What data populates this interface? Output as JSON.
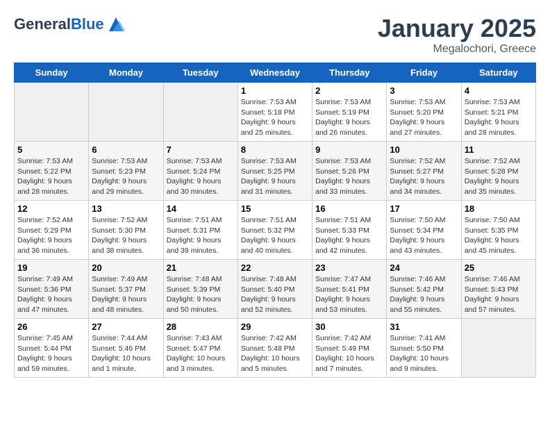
{
  "header": {
    "logo_general": "General",
    "logo_blue": "Blue",
    "main_title": "January 2025",
    "subtitle": "Megalochori, Greece"
  },
  "days_of_week": [
    "Sunday",
    "Monday",
    "Tuesday",
    "Wednesday",
    "Thursday",
    "Friday",
    "Saturday"
  ],
  "weeks": [
    [
      {
        "day": "",
        "empty": true
      },
      {
        "day": "",
        "empty": true
      },
      {
        "day": "",
        "empty": true
      },
      {
        "day": "1",
        "sunrise": "7:53 AM",
        "sunset": "5:18 PM",
        "daylight": "9 hours and 25 minutes."
      },
      {
        "day": "2",
        "sunrise": "7:53 AM",
        "sunset": "5:19 PM",
        "daylight": "9 hours and 26 minutes."
      },
      {
        "day": "3",
        "sunrise": "7:53 AM",
        "sunset": "5:20 PM",
        "daylight": "9 hours and 27 minutes."
      },
      {
        "day": "4",
        "sunrise": "7:53 AM",
        "sunset": "5:21 PM",
        "daylight": "9 hours and 28 minutes."
      }
    ],
    [
      {
        "day": "5",
        "sunrise": "7:53 AM",
        "sunset": "5:22 PM",
        "daylight": "9 hours and 28 minutes."
      },
      {
        "day": "6",
        "sunrise": "7:53 AM",
        "sunset": "5:23 PM",
        "daylight": "9 hours and 29 minutes."
      },
      {
        "day": "7",
        "sunrise": "7:53 AM",
        "sunset": "5:24 PM",
        "daylight": "9 hours and 30 minutes."
      },
      {
        "day": "8",
        "sunrise": "7:53 AM",
        "sunset": "5:25 PM",
        "daylight": "9 hours and 31 minutes."
      },
      {
        "day": "9",
        "sunrise": "7:53 AM",
        "sunset": "5:26 PM",
        "daylight": "9 hours and 33 minutes."
      },
      {
        "day": "10",
        "sunrise": "7:52 AM",
        "sunset": "5:27 PM",
        "daylight": "9 hours and 34 minutes."
      },
      {
        "day": "11",
        "sunrise": "7:52 AM",
        "sunset": "5:28 PM",
        "daylight": "9 hours and 35 minutes."
      }
    ],
    [
      {
        "day": "12",
        "sunrise": "7:52 AM",
        "sunset": "5:29 PM",
        "daylight": "9 hours and 36 minutes."
      },
      {
        "day": "13",
        "sunrise": "7:52 AM",
        "sunset": "5:30 PM",
        "daylight": "9 hours and 38 minutes."
      },
      {
        "day": "14",
        "sunrise": "7:51 AM",
        "sunset": "5:31 PM",
        "daylight": "9 hours and 39 minutes."
      },
      {
        "day": "15",
        "sunrise": "7:51 AM",
        "sunset": "5:32 PM",
        "daylight": "9 hours and 40 minutes."
      },
      {
        "day": "16",
        "sunrise": "7:51 AM",
        "sunset": "5:33 PM",
        "daylight": "9 hours and 42 minutes."
      },
      {
        "day": "17",
        "sunrise": "7:50 AM",
        "sunset": "5:34 PM",
        "daylight": "9 hours and 43 minutes."
      },
      {
        "day": "18",
        "sunrise": "7:50 AM",
        "sunset": "5:35 PM",
        "daylight": "9 hours and 45 minutes."
      }
    ],
    [
      {
        "day": "19",
        "sunrise": "7:49 AM",
        "sunset": "5:36 PM",
        "daylight": "9 hours and 47 minutes."
      },
      {
        "day": "20",
        "sunrise": "7:49 AM",
        "sunset": "5:37 PM",
        "daylight": "9 hours and 48 minutes."
      },
      {
        "day": "21",
        "sunrise": "7:48 AM",
        "sunset": "5:39 PM",
        "daylight": "9 hours and 50 minutes."
      },
      {
        "day": "22",
        "sunrise": "7:48 AM",
        "sunset": "5:40 PM",
        "daylight": "9 hours and 52 minutes."
      },
      {
        "day": "23",
        "sunrise": "7:47 AM",
        "sunset": "5:41 PM",
        "daylight": "9 hours and 53 minutes."
      },
      {
        "day": "24",
        "sunrise": "7:46 AM",
        "sunset": "5:42 PM",
        "daylight": "9 hours and 55 minutes."
      },
      {
        "day": "25",
        "sunrise": "7:46 AM",
        "sunset": "5:43 PM",
        "daylight": "9 hours and 57 minutes."
      }
    ],
    [
      {
        "day": "26",
        "sunrise": "7:45 AM",
        "sunset": "5:44 PM",
        "daylight": "9 hours and 59 minutes."
      },
      {
        "day": "27",
        "sunrise": "7:44 AM",
        "sunset": "5:46 PM",
        "daylight": "10 hours and 1 minute."
      },
      {
        "day": "28",
        "sunrise": "7:43 AM",
        "sunset": "5:47 PM",
        "daylight": "10 hours and 3 minutes."
      },
      {
        "day": "29",
        "sunrise": "7:42 AM",
        "sunset": "5:48 PM",
        "daylight": "10 hours and 5 minutes."
      },
      {
        "day": "30",
        "sunrise": "7:42 AM",
        "sunset": "5:49 PM",
        "daylight": "10 hours and 7 minutes."
      },
      {
        "day": "31",
        "sunrise": "7:41 AM",
        "sunset": "5:50 PM",
        "daylight": "10 hours and 9 minutes."
      },
      {
        "day": "",
        "empty": true
      }
    ]
  ]
}
